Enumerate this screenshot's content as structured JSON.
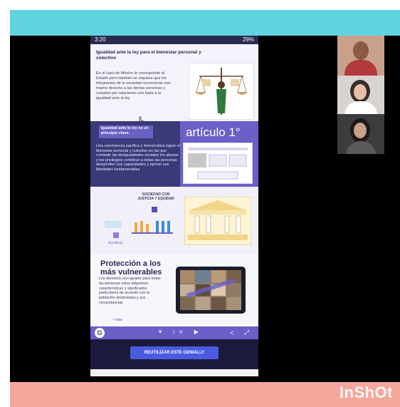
{
  "status_bar": {
    "time": "3:20",
    "battery": "29%"
  },
  "section1": {
    "title": "Igualdad ante la ley para el bienestar personal y colectivo",
    "body": "En el caso de México le corresponde al Estado pero también se requiere que los integrantes de la sociedad reconozcan ese mismo derecho a las demás personas y cumplan por relaciones con base a la igualdad ante la ley"
  },
  "section2": {
    "heading": "Igualdad ante la ley es un principio clave,",
    "body": "Una convivencia pacífica y democrática lograr el bienestar personal y colectivo en las que combatir las desigualdades sociales los abusos y los privilegios contribuir a todas las personas desarrollen sus capacidades y ejercer sus libertades fundamentales",
    "articulo": "artículo 1°"
  },
  "section3": {
    "title": "SOCIEDAD CON JUSTICIA Y EQUIDAD",
    "equidad_label": "EQUIDAD"
  },
  "section4": {
    "title": "Protección a los más vulnerables",
    "body": "Los derechos son iguales para todas las personas estos adquieren características y significados particulares de acuerdo con la población destinataria y sus circunstancias",
    "more": "• más"
  },
  "bottom_bar": {
    "logo": "G",
    "social": "▾ in ▶",
    "share": "<",
    "expand": "⤢"
  },
  "footer": {
    "reuse_label": "REUTILIZAR ESTE GENIALLY"
  },
  "watermark": {
    "label": "InShOt"
  },
  "colors": {
    "cyan_band": "#5fd4df",
    "pink_band": "#f6a79b",
    "accent": "#6b5fc8",
    "button": "#4a5be0"
  }
}
